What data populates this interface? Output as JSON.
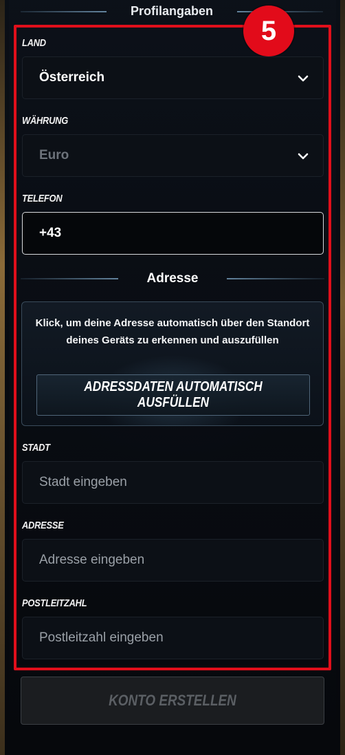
{
  "section": {
    "title": "Profilangaben"
  },
  "step": {
    "number": "5"
  },
  "country": {
    "label": "LAND",
    "value": "Österreich"
  },
  "currency": {
    "label": "WÄHRUNG",
    "value": "Euro"
  },
  "phone": {
    "label": "TELEFON",
    "value": "+43"
  },
  "address_section": {
    "title": "Adresse"
  },
  "autofill": {
    "description": "Klick, um deine Adresse automatisch über den Standort deines Geräts zu erkennen und auszufüllen",
    "button_label": "ADRESSDATEN AUTOMATISCH AUSFÜLLEN"
  },
  "city": {
    "label": "STADT",
    "placeholder": "Stadt eingeben"
  },
  "address": {
    "label": "ADRESSE",
    "placeholder": "Adresse eingeben"
  },
  "postal_code": {
    "label": "POSTLEITZAHL",
    "placeholder": "Postleitzahl eingeben"
  },
  "submit": {
    "label": "KONTO ERSTELLEN"
  },
  "colors": {
    "highlight": "#e10f1b",
    "badge": "#e20b1a",
    "disabled_text": "#5b5f64"
  },
  "icons": {
    "select_chevron": "chevron-down-icon"
  }
}
